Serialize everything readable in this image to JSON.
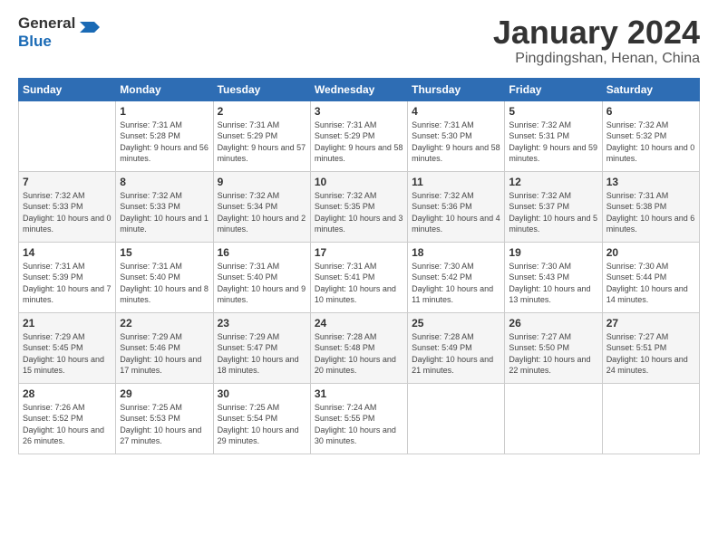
{
  "header": {
    "logo_general": "General",
    "logo_blue": "Blue",
    "month_title": "January 2024",
    "subtitle": "Pingdingshan, Henan, China"
  },
  "columns": [
    "Sunday",
    "Monday",
    "Tuesday",
    "Wednesday",
    "Thursday",
    "Friday",
    "Saturday"
  ],
  "weeks": [
    [
      {
        "day": "",
        "sunrise": "",
        "sunset": "",
        "daylight": ""
      },
      {
        "day": "1",
        "sunrise": "Sunrise: 7:31 AM",
        "sunset": "Sunset: 5:28 PM",
        "daylight": "Daylight: 9 hours and 56 minutes."
      },
      {
        "day": "2",
        "sunrise": "Sunrise: 7:31 AM",
        "sunset": "Sunset: 5:29 PM",
        "daylight": "Daylight: 9 hours and 57 minutes."
      },
      {
        "day": "3",
        "sunrise": "Sunrise: 7:31 AM",
        "sunset": "Sunset: 5:29 PM",
        "daylight": "Daylight: 9 hours and 58 minutes."
      },
      {
        "day": "4",
        "sunrise": "Sunrise: 7:31 AM",
        "sunset": "Sunset: 5:30 PM",
        "daylight": "Daylight: 9 hours and 58 minutes."
      },
      {
        "day": "5",
        "sunrise": "Sunrise: 7:32 AM",
        "sunset": "Sunset: 5:31 PM",
        "daylight": "Daylight: 9 hours and 59 minutes."
      },
      {
        "day": "6",
        "sunrise": "Sunrise: 7:32 AM",
        "sunset": "Sunset: 5:32 PM",
        "daylight": "Daylight: 10 hours and 0 minutes."
      }
    ],
    [
      {
        "day": "7",
        "sunrise": "Sunrise: 7:32 AM",
        "sunset": "Sunset: 5:33 PM",
        "daylight": "Daylight: 10 hours and 0 minutes."
      },
      {
        "day": "8",
        "sunrise": "Sunrise: 7:32 AM",
        "sunset": "Sunset: 5:33 PM",
        "daylight": "Daylight: 10 hours and 1 minute."
      },
      {
        "day": "9",
        "sunrise": "Sunrise: 7:32 AM",
        "sunset": "Sunset: 5:34 PM",
        "daylight": "Daylight: 10 hours and 2 minutes."
      },
      {
        "day": "10",
        "sunrise": "Sunrise: 7:32 AM",
        "sunset": "Sunset: 5:35 PM",
        "daylight": "Daylight: 10 hours and 3 minutes."
      },
      {
        "day": "11",
        "sunrise": "Sunrise: 7:32 AM",
        "sunset": "Sunset: 5:36 PM",
        "daylight": "Daylight: 10 hours and 4 minutes."
      },
      {
        "day": "12",
        "sunrise": "Sunrise: 7:32 AM",
        "sunset": "Sunset: 5:37 PM",
        "daylight": "Daylight: 10 hours and 5 minutes."
      },
      {
        "day": "13",
        "sunrise": "Sunrise: 7:31 AM",
        "sunset": "Sunset: 5:38 PM",
        "daylight": "Daylight: 10 hours and 6 minutes."
      }
    ],
    [
      {
        "day": "14",
        "sunrise": "Sunrise: 7:31 AM",
        "sunset": "Sunset: 5:39 PM",
        "daylight": "Daylight: 10 hours and 7 minutes."
      },
      {
        "day": "15",
        "sunrise": "Sunrise: 7:31 AM",
        "sunset": "Sunset: 5:40 PM",
        "daylight": "Daylight: 10 hours and 8 minutes."
      },
      {
        "day": "16",
        "sunrise": "Sunrise: 7:31 AM",
        "sunset": "Sunset: 5:40 PM",
        "daylight": "Daylight: 10 hours and 9 minutes."
      },
      {
        "day": "17",
        "sunrise": "Sunrise: 7:31 AM",
        "sunset": "Sunset: 5:41 PM",
        "daylight": "Daylight: 10 hours and 10 minutes."
      },
      {
        "day": "18",
        "sunrise": "Sunrise: 7:30 AM",
        "sunset": "Sunset: 5:42 PM",
        "daylight": "Daylight: 10 hours and 11 minutes."
      },
      {
        "day": "19",
        "sunrise": "Sunrise: 7:30 AM",
        "sunset": "Sunset: 5:43 PM",
        "daylight": "Daylight: 10 hours and 13 minutes."
      },
      {
        "day": "20",
        "sunrise": "Sunrise: 7:30 AM",
        "sunset": "Sunset: 5:44 PM",
        "daylight": "Daylight: 10 hours and 14 minutes."
      }
    ],
    [
      {
        "day": "21",
        "sunrise": "Sunrise: 7:29 AM",
        "sunset": "Sunset: 5:45 PM",
        "daylight": "Daylight: 10 hours and 15 minutes."
      },
      {
        "day": "22",
        "sunrise": "Sunrise: 7:29 AM",
        "sunset": "Sunset: 5:46 PM",
        "daylight": "Daylight: 10 hours and 17 minutes."
      },
      {
        "day": "23",
        "sunrise": "Sunrise: 7:29 AM",
        "sunset": "Sunset: 5:47 PM",
        "daylight": "Daylight: 10 hours and 18 minutes."
      },
      {
        "day": "24",
        "sunrise": "Sunrise: 7:28 AM",
        "sunset": "Sunset: 5:48 PM",
        "daylight": "Daylight: 10 hours and 20 minutes."
      },
      {
        "day": "25",
        "sunrise": "Sunrise: 7:28 AM",
        "sunset": "Sunset: 5:49 PM",
        "daylight": "Daylight: 10 hours and 21 minutes."
      },
      {
        "day": "26",
        "sunrise": "Sunrise: 7:27 AM",
        "sunset": "Sunset: 5:50 PM",
        "daylight": "Daylight: 10 hours and 22 minutes."
      },
      {
        "day": "27",
        "sunrise": "Sunrise: 7:27 AM",
        "sunset": "Sunset: 5:51 PM",
        "daylight": "Daylight: 10 hours and 24 minutes."
      }
    ],
    [
      {
        "day": "28",
        "sunrise": "Sunrise: 7:26 AM",
        "sunset": "Sunset: 5:52 PM",
        "daylight": "Daylight: 10 hours and 26 minutes."
      },
      {
        "day": "29",
        "sunrise": "Sunrise: 7:25 AM",
        "sunset": "Sunset: 5:53 PM",
        "daylight": "Daylight: 10 hours and 27 minutes."
      },
      {
        "day": "30",
        "sunrise": "Sunrise: 7:25 AM",
        "sunset": "Sunset: 5:54 PM",
        "daylight": "Daylight: 10 hours and 29 minutes."
      },
      {
        "day": "31",
        "sunrise": "Sunrise: 7:24 AM",
        "sunset": "Sunset: 5:55 PM",
        "daylight": "Daylight: 10 hours and 30 minutes."
      },
      {
        "day": "",
        "sunrise": "",
        "sunset": "",
        "daylight": ""
      },
      {
        "day": "",
        "sunrise": "",
        "sunset": "",
        "daylight": ""
      },
      {
        "day": "",
        "sunrise": "",
        "sunset": "",
        "daylight": ""
      }
    ]
  ]
}
